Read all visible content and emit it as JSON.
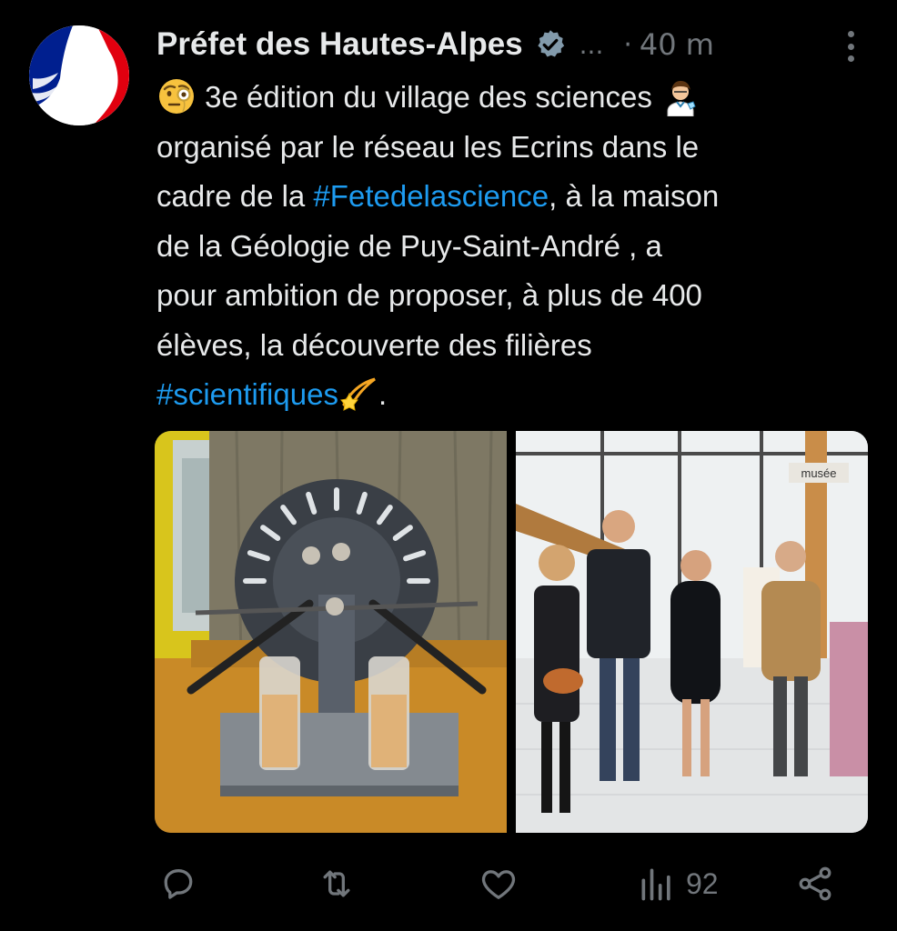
{
  "tweet": {
    "author": "Préfet des Hautes-Alpes",
    "truncation": "...",
    "separator": "·",
    "time": "40 m",
    "text": {
      "l1": "3e édition du village des sciences",
      "l2": "organisé par le réseau les Ecrins dans le",
      "l3a": "cadre de la ",
      "hashtag1": "#Fetedelascience",
      "l3b": ", à la maison",
      "l4": "de la Géologie de Puy-Saint-André , a",
      "l5": "pour ambition de proposer, à plus de 400",
      "l6": "élèves, la découverte des filières",
      "hashtag2": "#scientifiques",
      "end": "."
    },
    "emojis": [
      "monocle-face",
      "scientist",
      "dizzy"
    ],
    "media": [
      {
        "name": "wimshurst-machine-photo",
        "sign": ""
      },
      {
        "name": "group-visit-photo",
        "sign": "musée"
      }
    ],
    "actions": {
      "reply": "",
      "retweet": "",
      "like": "",
      "views": "92",
      "share": ""
    }
  },
  "colors": {
    "background": "#000000",
    "text": "#e7e9ea",
    "muted": "#71767b",
    "link": "#1d9bf0",
    "verified_badge": "#829aab"
  }
}
